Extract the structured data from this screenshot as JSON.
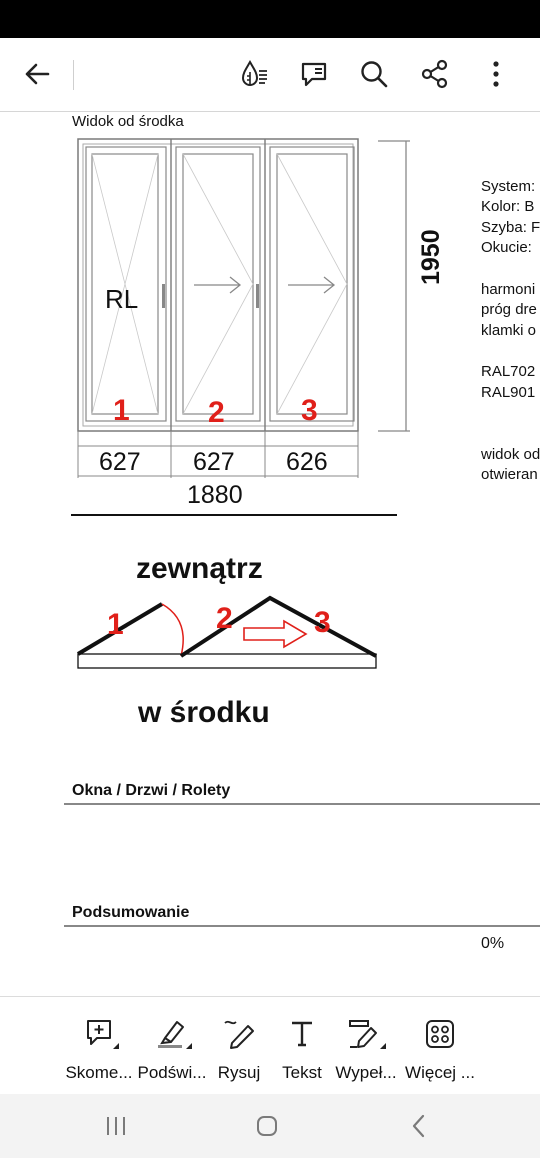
{
  "toolbar": {
    "back": "back-arrow-icon",
    "reading_mode": "liquid-mode-icon",
    "comments": "comment-list-icon",
    "search": "search-icon",
    "share": "share-icon",
    "more": "more-vertical-icon"
  },
  "document": {
    "view_title": "Widok od środka",
    "sash_label": "RL",
    "sash_numbers": [
      "1",
      "2",
      "3"
    ],
    "height_dim": "1950",
    "width_dims": [
      "627",
      "627",
      "626"
    ],
    "total_width": "1880",
    "right_lines_1": [
      "System:",
      "Kolor: B",
      "Szyba: F",
      "Okucie:"
    ],
    "right_lines_2": [
      "harmoni",
      "próg dre",
      "klamki o"
    ],
    "right_lines_3": [
      "RAL702",
      "RAL901"
    ],
    "right_lines_4": [
      "widok od",
      "otwieran"
    ],
    "outside_label": "zewnątrz",
    "inside_label": "w środku",
    "section_1": "Okna / Drzwi / Rolety",
    "section_2": "Podsumowanie",
    "percent": "0%"
  },
  "tools": [
    {
      "label": "Skome...",
      "icon": "add-comment-icon"
    },
    {
      "label": "Podświ...",
      "icon": "highlight-icon"
    },
    {
      "label": "Rysuj",
      "icon": "draw-icon"
    },
    {
      "label": "Tekst",
      "icon": "text-icon"
    },
    {
      "label": "Wypeł...",
      "icon": "fill-sign-icon"
    },
    {
      "label": "Więcej ...",
      "icon": "more-tools-icon"
    }
  ],
  "nav": {
    "recents": "recent-apps-icon",
    "home": "home-icon",
    "back": "back-icon"
  }
}
